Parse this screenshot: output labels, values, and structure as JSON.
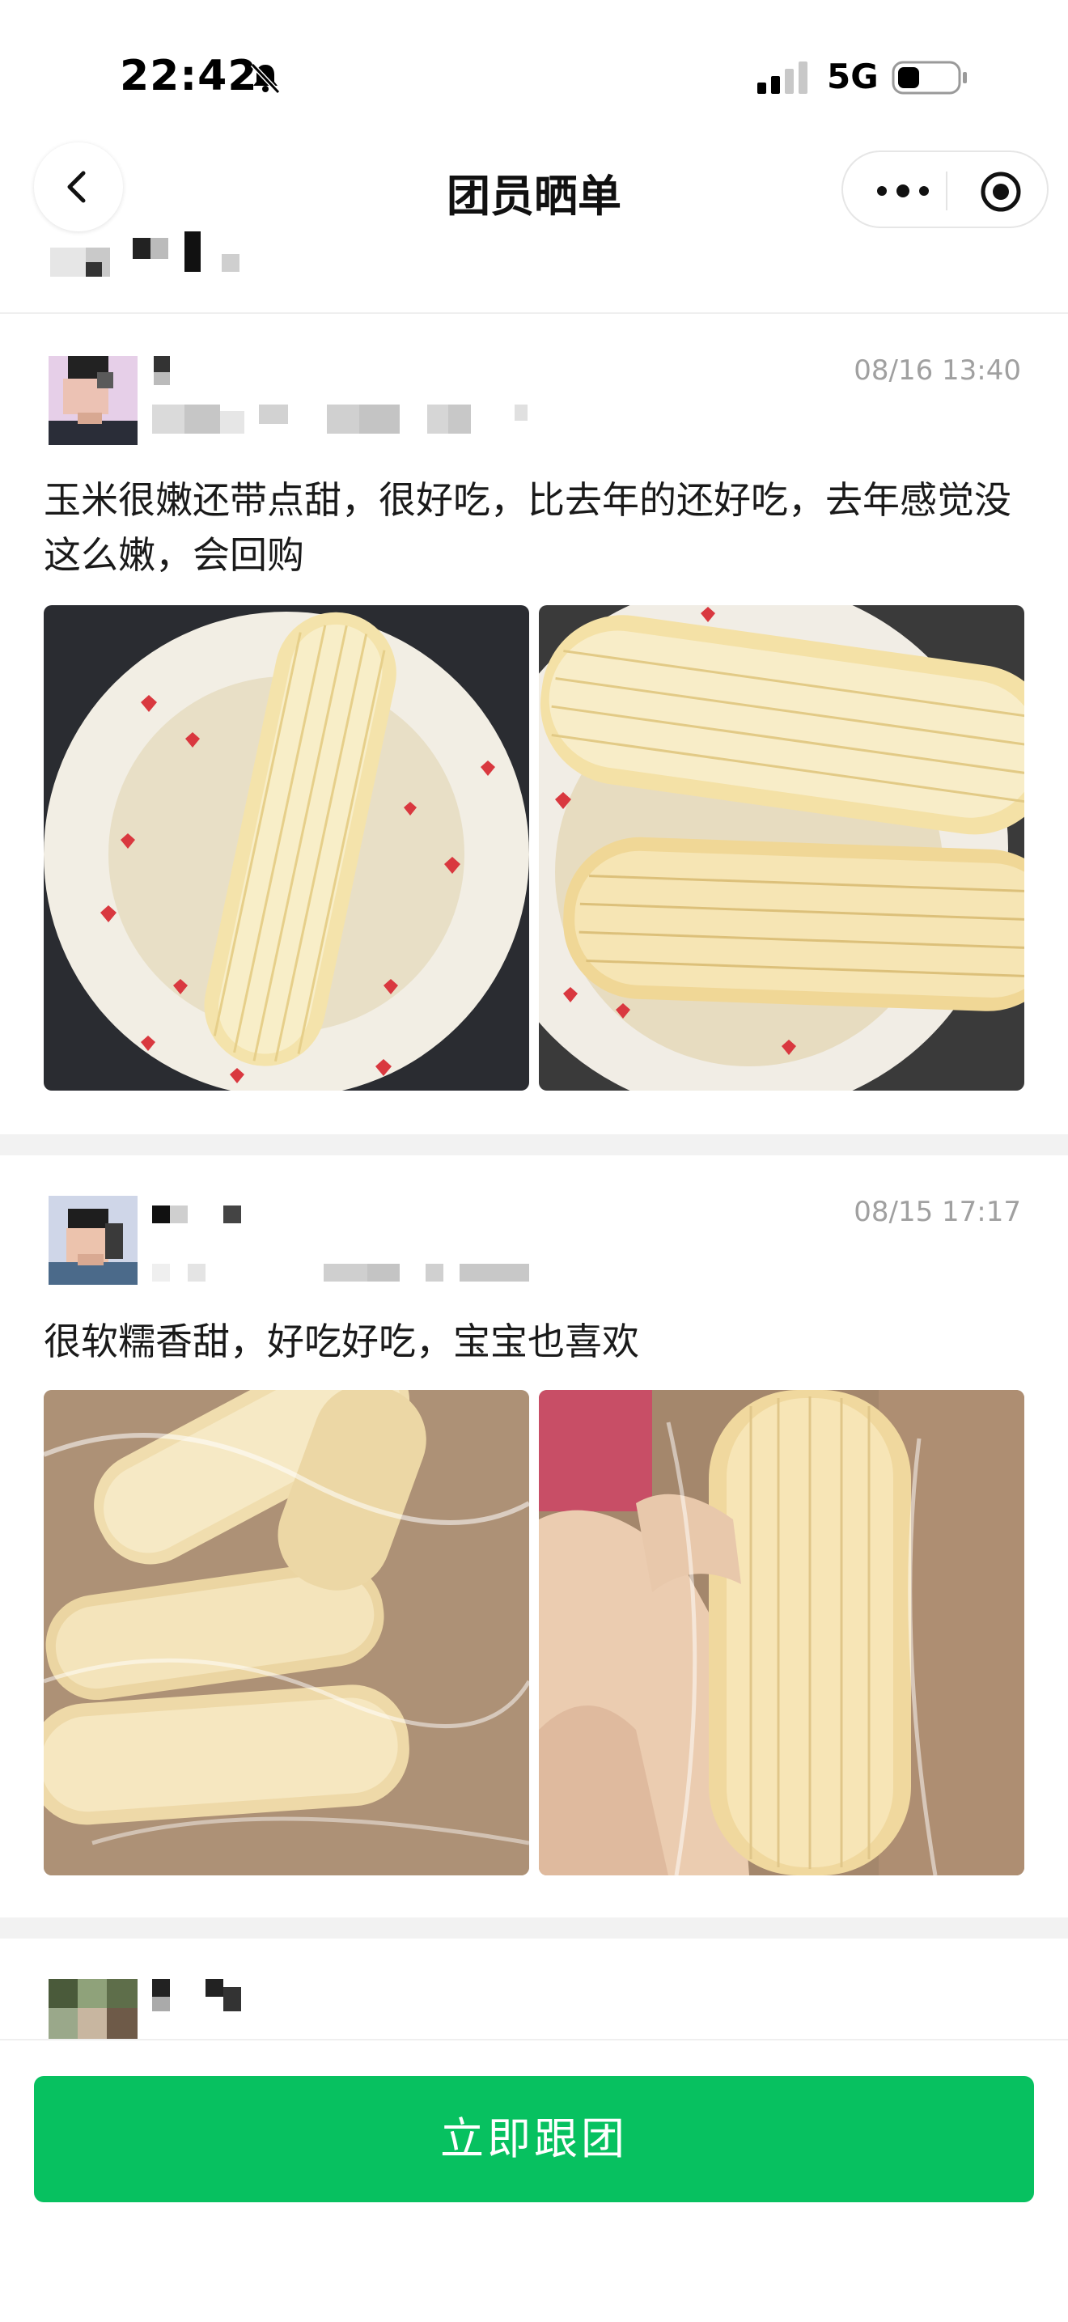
{
  "status_bar": {
    "time": "22:42",
    "network": "5G"
  },
  "nav": {
    "title": "团员晒单"
  },
  "posts": [
    {
      "time": "08/16 13:40",
      "text": "玉米很嫩还带点甜，很好吃，比去年的还好吃，去年感觉没这么嫩，会回购"
    },
    {
      "time": "08/15 17:17",
      "text": "很软糯香甜，好吃好吃，宝宝也喜欢"
    }
  ],
  "bottom": {
    "join_label": "立即跟团"
  },
  "colors": {
    "accent": "#07c160",
    "timestamp": "#a0a0a0",
    "gap": "#f2f2f2"
  }
}
